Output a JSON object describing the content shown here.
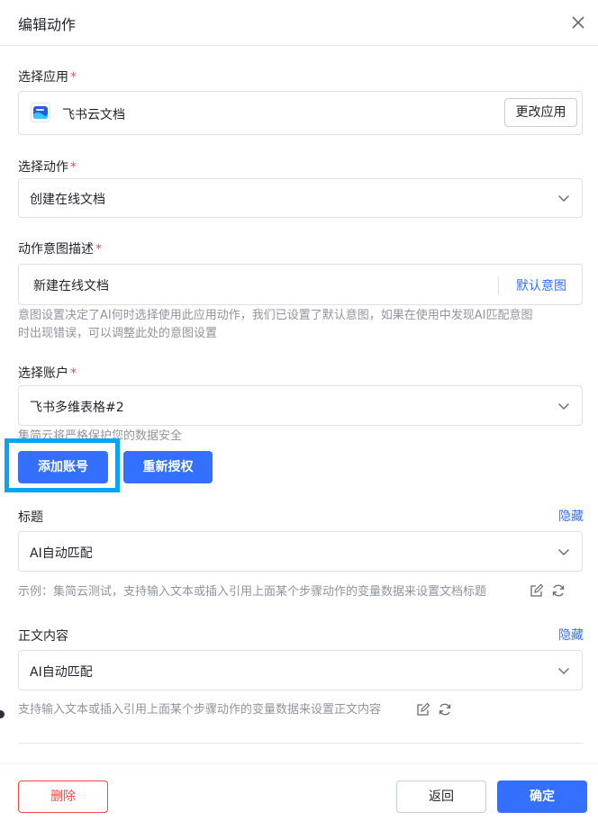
{
  "dialog": {
    "title": "编辑动作"
  },
  "fields": {
    "app": {
      "label": "选择应用",
      "required_mark": "*",
      "value": "飞书云文档",
      "change_button": "更改应用"
    },
    "action": {
      "label": "选择动作",
      "required_mark": "*",
      "value": "创建在线文档"
    },
    "intent": {
      "label": "动作意图描述",
      "required_mark": "*",
      "value": "新建在线文档",
      "default_link": "默认意图",
      "hint_line1": "意图设置决定了AI何时选择使用此应用动作，我们已设置了默认意图，如果在使用中发现AI匹配意图",
      "hint_line2": "时出现错误，可以调整此处的意图设置"
    },
    "account": {
      "label": "选择账户",
      "required_mark": "*",
      "value": "飞书多维表格#2",
      "hint": "集简云将严格保护您的数据安全",
      "add_button": "添加账号",
      "reauth_button": "重新授权"
    },
    "title_field": {
      "label": "标题",
      "hide_link": "隐藏",
      "value": "AI自动匹配",
      "hint": "示例：集简云测试，支持输入文本或插入引用上面某个步骤动作的变量数据来设置文档标题"
    },
    "body_field": {
      "label": "正文内容",
      "hide_link": "隐藏",
      "value": "AI自动匹配",
      "hint": "支持输入文本或插入引用上面某个步骤动作的变量数据来设置正文内容"
    }
  },
  "footer": {
    "delete": "删除",
    "back": "返回",
    "confirm": "确定"
  },
  "colors": {
    "accent": "#3370ff",
    "danger": "#f54a45",
    "highlight": "#0aa4f5"
  }
}
